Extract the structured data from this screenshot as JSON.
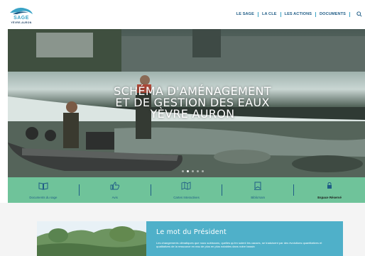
{
  "logo": {
    "name": "SAGE",
    "subtitle": "YÈVRE-AURON"
  },
  "nav": {
    "items": [
      "LE SAGE",
      "LA CLE",
      "LES ACTIONS",
      "DOCUMENTS"
    ]
  },
  "hero": {
    "title_lines": [
      "SCHÉMA D'AMÉNAGEMENT",
      "ET DE GESTION DES EAUX",
      "YÈVRE AURON"
    ],
    "slides": 5,
    "active_slide": 1
  },
  "quicklinks": [
    {
      "label": "Documents du sage",
      "icon": "book-icon"
    },
    {
      "label": "Avis",
      "icon": "thumbs-up-icon"
    },
    {
      "label": "Cartes Interactives",
      "icon": "map-icon"
    },
    {
      "label": "Biblio'sam",
      "icon": "bookmark-icon"
    },
    {
      "label": "Espace Réservé",
      "icon": "lock-icon"
    }
  ],
  "president": {
    "title": "Le mot du Président",
    "text": "Les changements climatiques que nous subissons, quelles qu'en soient les causes, se traduisent par des évolutions quantitatives et qualitatives de la ressource en eau de plus en plus notables dans notre bassin"
  },
  "colors": {
    "accent": "#1f5c86",
    "green": "#6fc39a",
    "teal": "#4fb0c9",
    "logo": "#3aa3c6"
  }
}
